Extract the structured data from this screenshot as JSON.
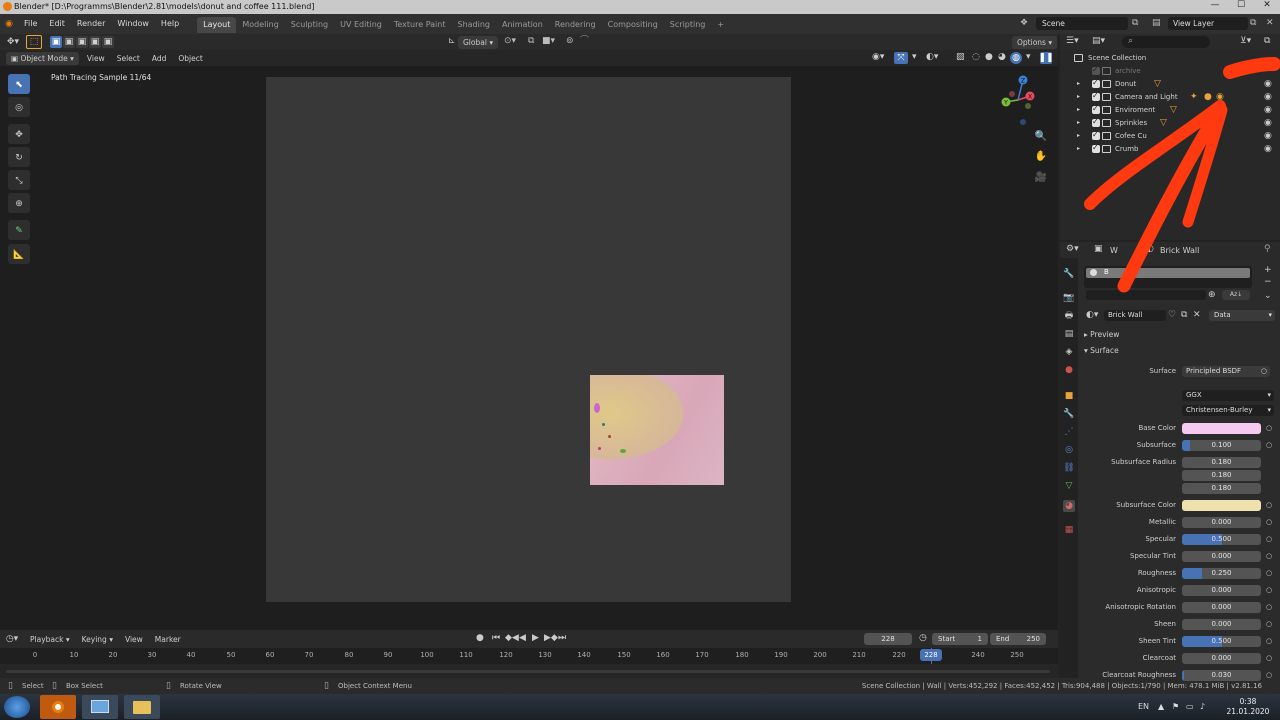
{
  "window": {
    "title": "Blender* [D:\\Programms\\Blender\\2.81\\models\\donut and coffee 111.blend]",
    "minimize": "—",
    "maximize": "☐",
    "close": "✕"
  },
  "menubar": {
    "items": [
      "File",
      "Edit",
      "Render",
      "Window",
      "Help"
    ],
    "workspaces": [
      "Layout",
      "Modeling",
      "Sculpting",
      "UV Editing",
      "Texture Paint",
      "Shading",
      "Animation",
      "Rendering",
      "Compositing",
      "Scripting"
    ],
    "active_workspace": "Layout",
    "add_workspace": "+",
    "scene": "Scene",
    "view_layer": "View Layer"
  },
  "viewport_header": {
    "transform_orientation": "Global",
    "options": "Options",
    "mode": "Object Mode",
    "menus": [
      "View",
      "Select",
      "Add",
      "Object"
    ]
  },
  "viewport": {
    "sample_text": "Path Tracing Sample 11/64",
    "gizmo": {
      "x": "X",
      "y": "Y",
      "z": "Z"
    }
  },
  "outliner": {
    "search_placeholder": "",
    "root": "Scene Collection",
    "items": [
      {
        "label": "archive",
        "checked": false
      },
      {
        "label": "Donut",
        "checked": true
      },
      {
        "label": "Camera and Light",
        "checked": true
      },
      {
        "label": "Enviroment",
        "checked": true
      },
      {
        "label": "Sprinkles",
        "checked": true
      },
      {
        "label": "Cofee Cu",
        "checked": true
      },
      {
        "label": "Crumb",
        "checked": true
      }
    ]
  },
  "properties": {
    "header_material": "Brick Wall",
    "header_prefix": "W",
    "slot_name": "B",
    "material_name": "Brick Wall",
    "link": "Data",
    "sections": {
      "preview": "Preview",
      "surface": "Surface"
    },
    "surface_shader": "Principled BSDF",
    "distribution": "GGX",
    "subsurface_method": "Christensen-Burley",
    "base_color": "#f5c9f0",
    "subsurface_color": "#efe0b0",
    "fields": [
      {
        "label": "Base Color",
        "kind": "color",
        "color": "#f5c9f0"
      },
      {
        "label": "Subsurface",
        "value": "0.100",
        "fill": 0.1
      },
      {
        "label": "Subsurface Radius",
        "value": "0.180",
        "fill": 0
      },
      {
        "label": "",
        "value": "0.180",
        "fill": 0
      },
      {
        "label": "",
        "value": "0.180",
        "fill": 0
      },
      {
        "label": "Subsurface Color",
        "kind": "color",
        "color": "#efe0b0"
      },
      {
        "label": "Metallic",
        "value": "0.000",
        "fill": 0
      },
      {
        "label": "Specular",
        "value": "0.500",
        "fill": 0.5
      },
      {
        "label": "Specular Tint",
        "value": "0.000",
        "fill": 0
      },
      {
        "label": "Roughness",
        "value": "0.250",
        "fill": 0.25
      },
      {
        "label": "Anisotropic",
        "value": "0.000",
        "fill": 0
      },
      {
        "label": "Anisotropic Rotation",
        "value": "0.000",
        "fill": 0
      },
      {
        "label": "Sheen",
        "value": "0.000",
        "fill": 0
      },
      {
        "label": "Sheen Tint",
        "value": "0.500",
        "fill": 0.5
      },
      {
        "label": "Clearcoat",
        "value": "0.000",
        "fill": 0
      },
      {
        "label": "Clearcoat Roughness",
        "value": "0.030",
        "fill": 0.03
      }
    ]
  },
  "timeline": {
    "menus": [
      "Playback",
      "Keying",
      "View",
      "Marker"
    ],
    "current_frame": "228",
    "start_label": "Start",
    "start": "1",
    "end_label": "End",
    "end": "250",
    "ruler": [
      "0",
      "10",
      "20",
      "30",
      "40",
      "50",
      "60",
      "70",
      "80",
      "90",
      "100",
      "110",
      "120",
      "130",
      "140",
      "150",
      "160",
      "170",
      "180",
      "190",
      "200",
      "210",
      "220",
      "228",
      "240",
      "250"
    ],
    "playhead": "228"
  },
  "statusbar": {
    "select": "Select",
    "box_select": "Box Select",
    "rotate_view": "Rotate View",
    "context_menu": "Object Context Menu",
    "stats": "Scene Collection | Wall | Verts:452,292 | Faces:452,452 | Tris:904,488 | Objects:1/790 | Mem: 478.1 MiB | v2.81.16"
  },
  "taskbar": {
    "language": "EN",
    "time": "0:38",
    "date": "21.01.2020"
  },
  "annotation_color": "#ff3a10"
}
